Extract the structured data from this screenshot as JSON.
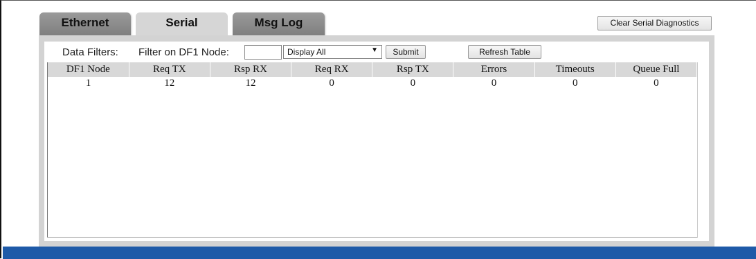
{
  "tabs": [
    {
      "label": "Ethernet",
      "active": false
    },
    {
      "label": "Serial",
      "active": true
    },
    {
      "label": "Msg Log",
      "active": false
    }
  ],
  "clear_button_label": "Clear Serial Diagnostics",
  "filters": {
    "label": "Data Filters:",
    "node_label": "Filter on DF1 Node:",
    "node_value": "",
    "display_select": "Display All",
    "submit_label": "Submit",
    "refresh_label": "Refresh Table"
  },
  "table": {
    "columns": [
      "DF1 Node",
      "Req TX",
      "Rsp RX",
      "Req RX",
      "Rsp TX",
      "Errors",
      "Timeouts",
      "Queue Full"
    ],
    "rows": [
      [
        "1",
        "12",
        "12",
        "0",
        "0",
        "0",
        "0",
        "0"
      ]
    ]
  },
  "colors": {
    "bottom_bar": "#1e5aa8",
    "panel": "#d3d3d3"
  }
}
